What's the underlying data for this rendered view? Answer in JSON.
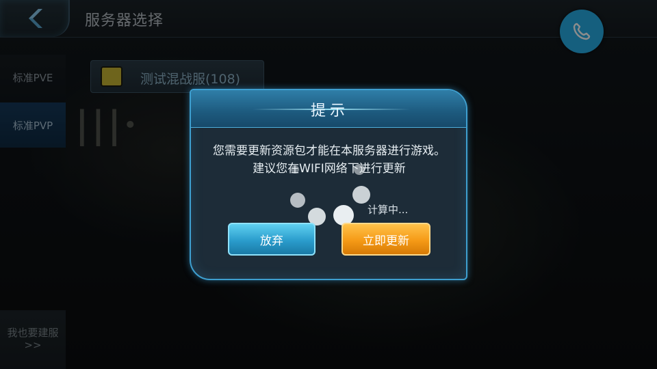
{
  "header": {
    "title": "服务器选择",
    "back_icon": "chevron-left-icon",
    "call_icon": "phone-icon",
    "call_color": "#27aee6"
  },
  "sidebar": {
    "items": [
      {
        "label": "标准PVE",
        "active": false
      },
      {
        "label": "标准PVP",
        "active": true
      }
    ],
    "build_label": "我也要建服>>"
  },
  "server_list": {
    "items": [
      {
        "name": "测试混战服(108)",
        "status_color": "#c9b634"
      }
    ]
  },
  "dialog": {
    "title": "提示",
    "message": "您需要更新资源包才能在本服务器进行游戏。建议您在WIFI网络下进行更新",
    "progress_text": "计算中...",
    "cancel_label": "放弃",
    "confirm_label": "立即更新",
    "cancel_color": "#2a9ccc",
    "confirm_color": "#f59a16",
    "spinner_icon": "loading-spinner-icon"
  }
}
